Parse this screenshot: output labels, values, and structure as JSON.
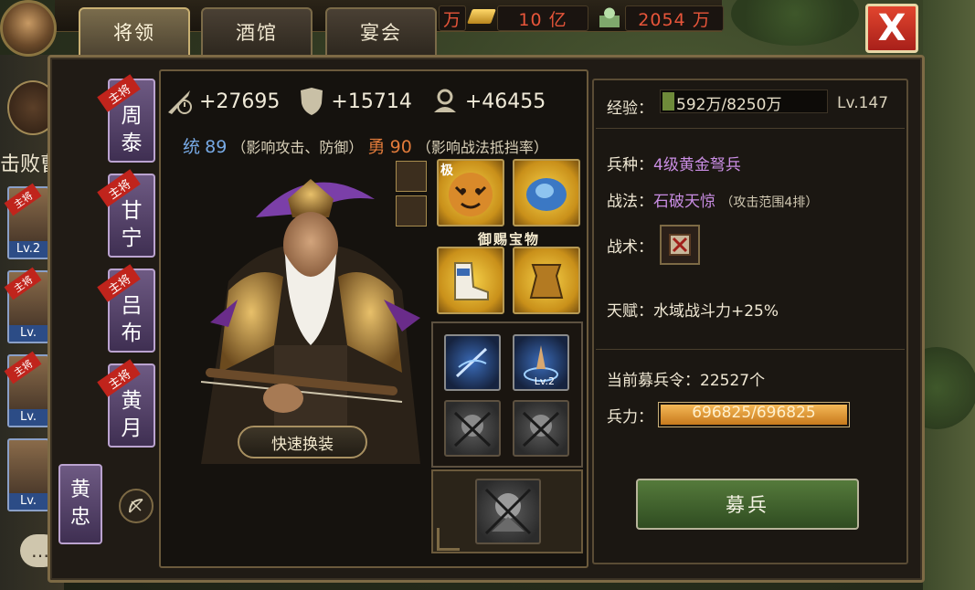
{
  "topbar": {
    "tabs": [
      {
        "label": "将领",
        "active": true
      },
      {
        "label": "酒馆",
        "active": false
      },
      {
        "label": "宴会",
        "active": false
      }
    ],
    "resources": [
      {
        "icon": "gold-icon",
        "value": "10 亿"
      },
      {
        "icon": "troop-icon",
        "value": "2054 万"
      }
    ],
    "partial_resource": "万",
    "close_label": "X"
  },
  "left_sidebar": {
    "mission_text": "击败曹仁",
    "thumbs": [
      {
        "lv": "Lv.2",
        "tag": "主将"
      },
      {
        "lv": "Lv.",
        "tag": "主将"
      },
      {
        "lv": "Lv.",
        "tag": "主将"
      },
      {
        "lv": "Lv.",
        "tag": ""
      }
    ]
  },
  "roster": {
    "generals": [
      {
        "tag": "主将",
        "name_1": "周",
        "name_2": "泰"
      },
      {
        "tag": "主将",
        "name_1": "甘",
        "name_2": "宁"
      },
      {
        "tag": "主将",
        "name_1": "吕",
        "name_2": "布"
      },
      {
        "tag": "主将",
        "name_1": "黄",
        "name_2": "月"
      }
    ],
    "selected": {
      "name_1": "黄",
      "name_2": "忠"
    }
  },
  "stats": {
    "attack": "+27695",
    "defense": "+15714",
    "troop": "+46455",
    "command_label": "统",
    "command_value": "89",
    "command_desc": "（影响攻击、防御）",
    "valor_label": "勇",
    "valor_value": "90",
    "valor_desc": "（影响战法抵挡率）"
  },
  "equipment": {
    "treasure_label": "御赐宝物",
    "quick_change_label": "快速换装",
    "treasure_slot_tag": "极",
    "skill_lv": "Lv.2"
  },
  "details": {
    "exp_label": "经验：",
    "exp_value": "592万/8250万",
    "exp_fraction": 0.072,
    "level": "Lv.147",
    "unit_label": "兵种：",
    "unit_value": "4级黄金弩兵",
    "tactic_label": "战法：",
    "tactic_value": "石破天惊",
    "tactic_note": "（攻击范围4排）",
    "skill_label": "战术：",
    "talent_label": "天赋：",
    "talent_value": "水域战斗力+25%",
    "recruit_order_label": "当前募兵令：",
    "recruit_order_value": "22527个",
    "troop_label": "兵力：",
    "troop_value": "696825/696825",
    "troop_fraction": 1.0,
    "recruit_button": "募兵"
  },
  "colors": {
    "accent_gold": "#b79a54",
    "purple_text": "#c98de3",
    "resource_red": "#e7553a",
    "recruit_green": "#557a3b"
  }
}
